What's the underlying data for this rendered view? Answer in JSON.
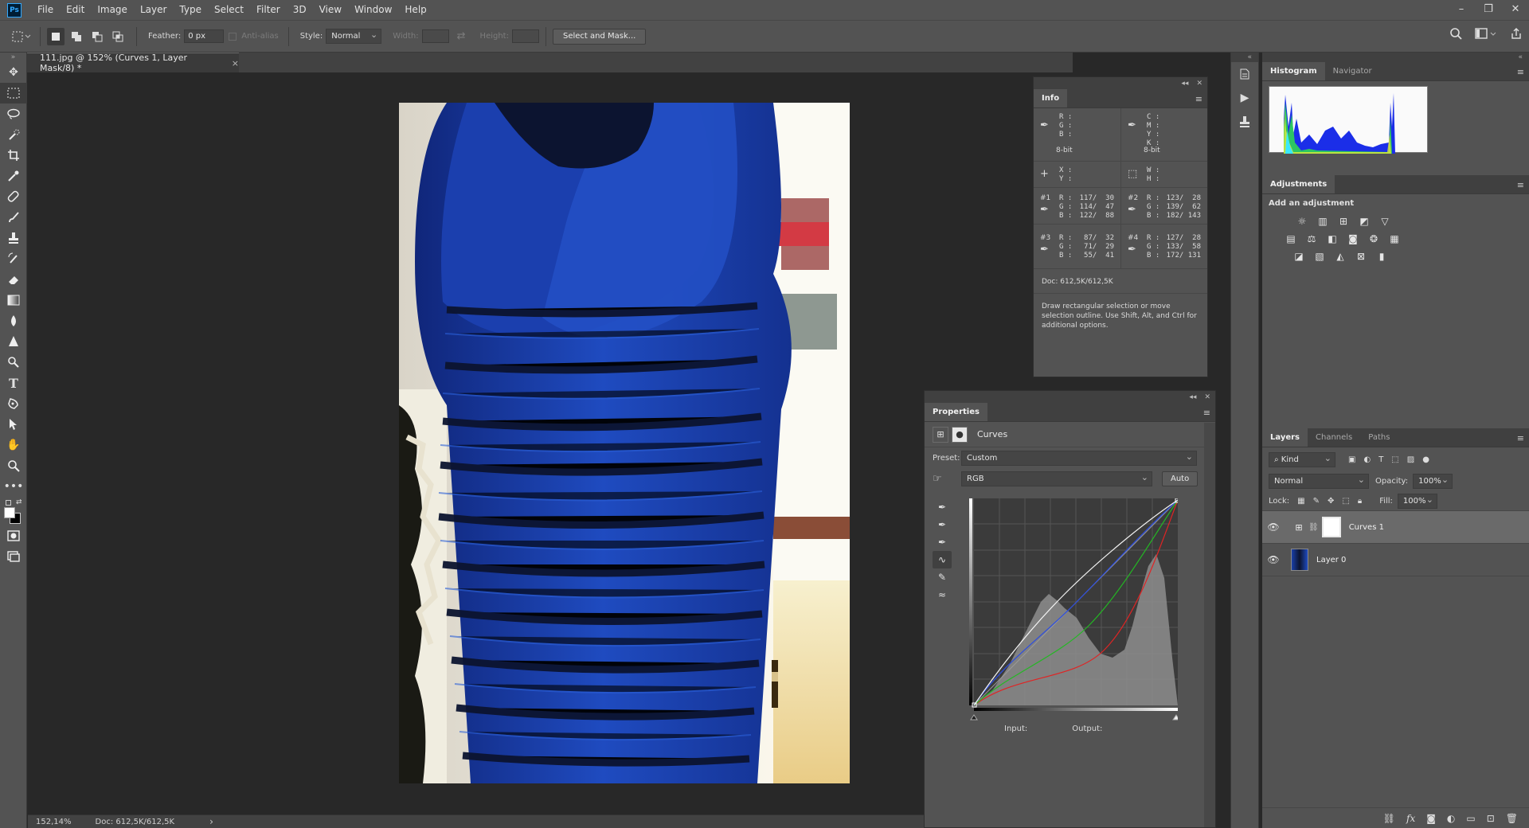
{
  "app": {
    "logo": "Ps"
  },
  "menu": [
    "File",
    "Edit",
    "Image",
    "Layer",
    "Type",
    "Select",
    "Filter",
    "3D",
    "View",
    "Window",
    "Help"
  ],
  "window_controls": {
    "minimize": "–",
    "restore": "❐",
    "close": "✕"
  },
  "options": {
    "feather_label": "Feather:",
    "feather_value": "0 px",
    "antialias_label": "Anti-alias",
    "style_label": "Style:",
    "style_value": "Normal",
    "width_label": "Width:",
    "height_label": "Height:",
    "select_mask_label": "Select and Mask..."
  },
  "document": {
    "tab_title": "111.jpg @ 152% (Curves 1, Layer Mask/8) *",
    "tab_close": "×",
    "zoom": "152,14%",
    "doc_size": "Doc: 612,5K/612,5K",
    "status_arrow": "›"
  },
  "info_panel": {
    "tab": "Info",
    "rgb_labels": "R :\nG :\nB :",
    "cmyk_labels": "C :\nM :\nY :\nK :",
    "bit_left": "8-bit",
    "bit_right": "8-bit",
    "xy_labels": "X :\nY :",
    "wh_labels": "W :\nH :",
    "samples": [
      {
        "tag": "#1",
        "labels": "R :\nG :\nB :",
        "values": "117/  30\n114/  47\n122/  88"
      },
      {
        "tag": "#2",
        "labels": "R :\nG :\nB :",
        "values": "123/  28\n139/  62\n182/ 143"
      },
      {
        "tag": "#3",
        "labels": "R :\nG :\nB :",
        "values": " 87/  32\n 71/  29\n 55/  41"
      },
      {
        "tag": "#4",
        "labels": "R :\nG :\nB :",
        "values": "127/  28\n133/  58\n172/ 131"
      }
    ],
    "doc": "Doc: 612,5K/612,5K",
    "help": "Draw rectangular selection or move selection outline.  Use Shift, Alt, and Ctrl for additional options."
  },
  "properties": {
    "tab": "Properties",
    "title": "Curves",
    "preset_label": "Preset:",
    "preset_value": "Custom",
    "channel_value": "RGB",
    "auto_label": "Auto",
    "input_label": "Input:",
    "output_label": "Output:"
  },
  "right_panels": {
    "histogram_tab": "Histogram",
    "navigator_tab": "Navigator",
    "adjustments_tab": "Adjustments",
    "add_adjustment": "Add an adjustment"
  },
  "layers": {
    "tabs": [
      "Layers",
      "Channels",
      "Paths"
    ],
    "kind_label": "Kind",
    "blend_mode": "Normal",
    "opacity_label": "Opacity:",
    "opacity_value": "100%",
    "lock_label": "Lock:",
    "fill_label": "Fill:",
    "fill_value": "100%",
    "items": [
      {
        "name": "Curves 1",
        "selected": true
      },
      {
        "name": "Layer 0",
        "selected": false
      }
    ]
  },
  "colors": {
    "ui_bg": "#535353",
    "canvas_bg": "#282828",
    "accent_ps": "#31a8ff",
    "dress_blue": "#1a3fa8",
    "dress_black": "#0c1430"
  }
}
